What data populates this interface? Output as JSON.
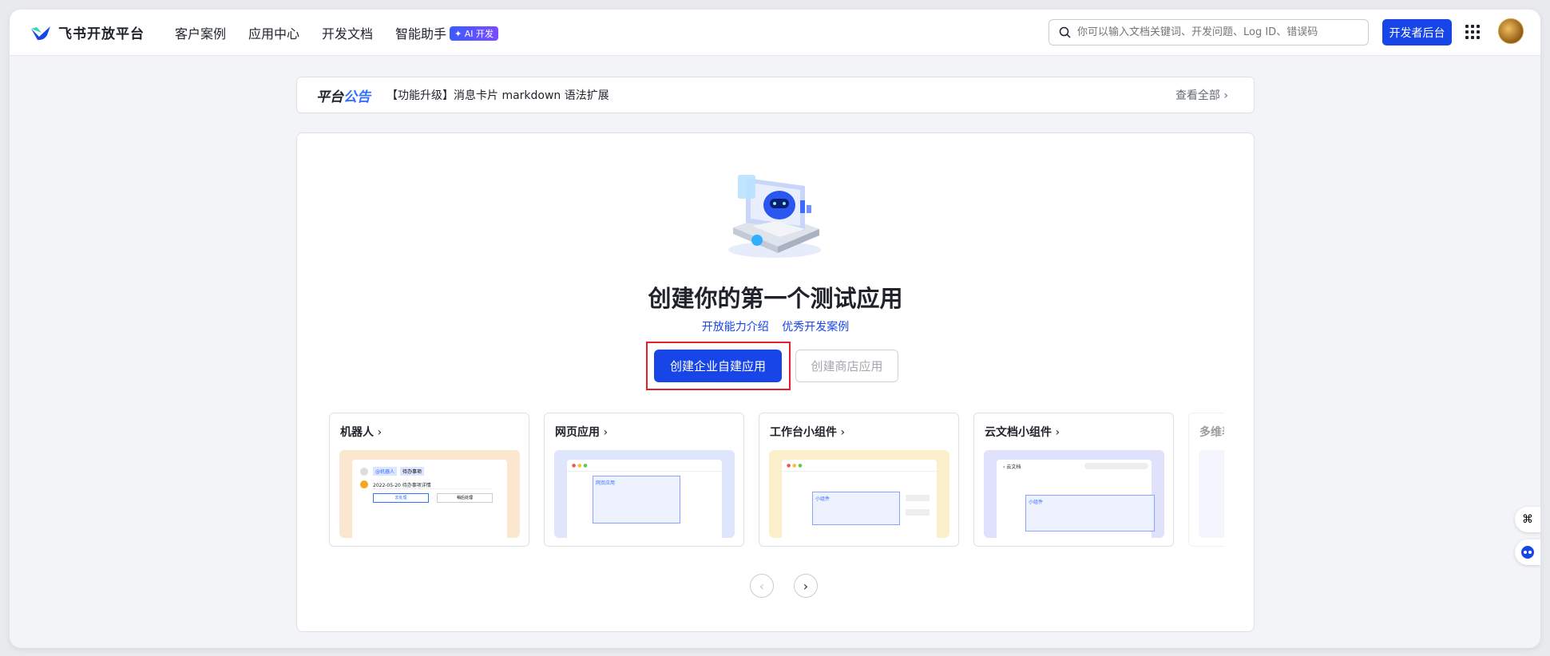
{
  "header": {
    "logo_text": "飞书开放平台",
    "nav": [
      "客户案例",
      "应用中心",
      "开发文档",
      "智能助手"
    ],
    "ai_badge": "✦ AI 开发",
    "search_placeholder": "你可以输入文档关键词、开发问题、Log ID、错误码",
    "dev_console_label": "开发者后台"
  },
  "announcement": {
    "title_part1": "平台",
    "title_part2": "公告",
    "text": "【功能升级】消息卡片 markdown 语法扩展",
    "more_label": "查看全部 ›"
  },
  "main": {
    "title": "创建你的第一个测试应用",
    "link1": "开放能力介绍",
    "link2": "优秀开发案例",
    "primary_button": "创建企业自建应用",
    "secondary_button": "创建商店应用"
  },
  "cards": [
    {
      "title": "机器人",
      "bg": "#fbe6cf"
    },
    {
      "title": "网页应用",
      "bg": "#dfe6fb"
    },
    {
      "title": "工作台小组件",
      "bg": "#fbefcc"
    },
    {
      "title": "云文档小组件",
      "bg": "#dfe2fa"
    },
    {
      "title": "多维表格",
      "bg": "#e8e9fb"
    }
  ],
  "card_preview_text": {
    "bot_tag": "@机器人",
    "bot_tag2": "待办事项",
    "bot_line": "2022-05-20 待办事项详情",
    "bot_btn1": "去处理",
    "bot_btn2": "稍后处理",
    "web_app": "网页应用",
    "widget": "小组件",
    "doc": "云文档"
  },
  "colors": {
    "brand": "#1745e8",
    "highlight": "#e5202a",
    "accent": "#3370ff"
  }
}
